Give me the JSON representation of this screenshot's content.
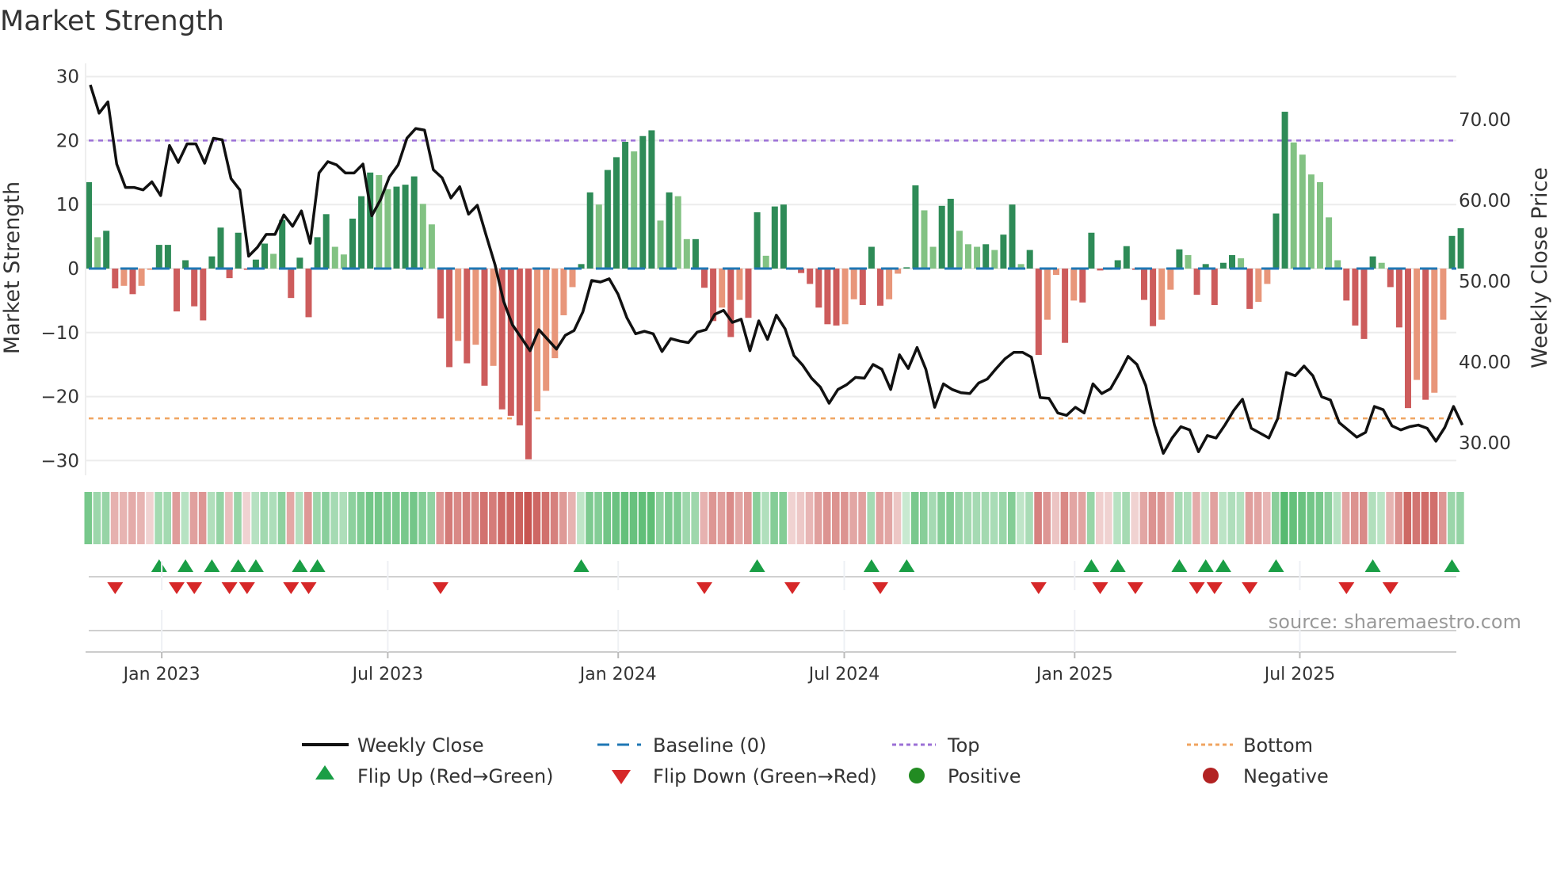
{
  "title": "Market Strength",
  "source": "source: sharemaestro.com",
  "chart_data": {
    "type": "bar",
    "title": "Market Strength",
    "ylabel": "Market Strength",
    "y2label": "Weekly Close Price",
    "ylim": [
      -32,
      32
    ],
    "y2lim": [
      26.6,
      76.2
    ],
    "yticks": [
      30,
      20,
      10,
      0,
      -10,
      -20,
      -30
    ],
    "yticklabels": [
      "30",
      "20",
      "10",
      "0",
      "−10",
      "−20",
      "−30"
    ],
    "y2ticks": [
      70,
      60,
      50,
      40,
      30
    ],
    "y2ticklabels": [
      "70.00",
      "60.00",
      "50.00",
      "40.00",
      "30.00"
    ],
    "xticks": [
      {
        "week": 8.3,
        "label": "Jan 2023"
      },
      {
        "week": 34.0,
        "label": "Jul 2023"
      },
      {
        "week": 60.2,
        "label": "Jan 2024"
      },
      {
        "week": 85.9,
        "label": "Jul 2024"
      },
      {
        "week": 112.1,
        "label": "Jan 2025"
      },
      {
        "week": 137.7,
        "label": "Jul 2025"
      }
    ],
    "top_level": 20,
    "bottom_level": -23.4,
    "baseline": 0,
    "strength": [
      13.5,
      4.9,
      5.9,
      -3.1,
      -2.7,
      -4.0,
      -2.7,
      -0.2,
      3.7,
      3.7,
      -6.7,
      1.3,
      -5.9,
      -8.1,
      1.9,
      6.4,
      -1.5,
      5.6,
      -0.2,
      1.4,
      3.9,
      2.3,
      7.6,
      -4.6,
      1.7,
      -7.6,
      4.9,
      8.5,
      3.4,
      2.2,
      7.8,
      11.3,
      15.0,
      14.6,
      12.4,
      12.8,
      13.1,
      14.4,
      10.1,
      6.9,
      -7.8,
      -15.4,
      -11.3,
      -14.8,
      -11.9,
      -18.3,
      -15.2,
      -22.0,
      -23.0,
      -24.5,
      -29.8,
      -22.3,
      -19.1,
      -14.0,
      -7.3,
      -2.9,
      0.7,
      11.9,
      10.0,
      15.4,
      17.4,
      19.8,
      18.3,
      20.7,
      21.6,
      7.5,
      11.9,
      11.3,
      4.6,
      4.6,
      -3.0,
      -8.2,
      -6.1,
      -10.7,
      -4.9,
      -7.7,
      8.8,
      2.0,
      9.7,
      10.0,
      -0.2,
      -0.7,
      -2.4,
      -6.1,
      -8.7,
      -8.9,
      -8.7,
      -4.8,
      -5.7,
      3.4,
      -5.8,
      -4.8,
      -0.8,
      0.2,
      13.0,
      9.1,
      3.4,
      9.8,
      10.9,
      5.9,
      3.8,
      3.4,
      3.8,
      2.9,
      5.3,
      10.0,
      0.7,
      2.9,
      -13.5,
      -8.0,
      -1.0,
      -11.6,
      -5.0,
      -5.3,
      5.6,
      -0.3,
      -0.2,
      1.3,
      3.5,
      -0.2,
      -4.9,
      -9.0,
      -8.0,
      -3.3,
      3.0,
      2.1,
      -4.1,
      0.7,
      -5.7,
      0.9,
      2.1,
      1.6,
      -6.3,
      -5.2,
      -2.4,
      8.6,
      24.5,
      19.7,
      17.8,
      14.7,
      13.5,
      8.0,
      1.3,
      -5.0,
      -8.9,
      -11.0,
      1.9,
      0.9,
      -2.9,
      -9.2,
      -21.8,
      -17.4,
      -20.5,
      -19.4,
      -8.0,
      5.1,
      6.3
    ],
    "close": [
      74.3,
      70.8,
      72.2,
      64.5,
      61.6,
      61.6,
      61.3,
      62.3,
      60.6,
      66.8,
      64.7,
      67.0,
      67.0,
      64.6,
      67.7,
      67.5,
      62.7,
      61.3,
      53.1,
      54.2,
      55.8,
      55.8,
      58.2,
      56.8,
      58.7,
      54.7,
      63.4,
      64.8,
      64.4,
      63.4,
      63.4,
      64.5,
      58.1,
      60.1,
      62.9,
      64.4,
      67.7,
      68.9,
      68.7,
      63.8,
      62.8,
      60.3,
      61.7,
      58.3,
      59.4,
      55.7,
      52.1,
      47.5,
      44.6,
      43.0,
      41.4,
      44.0,
      42.8,
      41.6,
      43.3,
      43.9,
      46.2,
      50.1,
      49.9,
      50.3,
      48.4,
      45.5,
      43.5,
      43.8,
      43.5,
      41.3,
      42.9,
      42.6,
      42.4,
      43.7,
      44.0,
      45.9,
      46.4,
      44.9,
      45.3,
      41.4,
      45.1,
      42.8,
      45.8,
      44.1,
      40.8,
      39.6,
      38.0,
      36.9,
      34.9,
      36.6,
      37.2,
      38.1,
      38.0,
      39.7,
      39.1,
      36.6,
      40.9,
      39.2,
      41.8,
      39.1,
      34.4,
      37.3,
      36.6,
      36.2,
      36.1,
      37.4,
      37.9,
      39.2,
      40.4,
      41.2,
      41.2,
      40.6,
      35.6,
      35.5,
      33.7,
      33.4,
      34.4,
      33.7,
      37.3,
      36.1,
      36.7,
      38.6,
      40.7,
      39.7,
      37.1,
      32.2,
      28.7,
      30.6,
      32.0,
      31.6,
      28.9,
      30.9,
      30.6,
      32.2,
      34.0,
      35.4,
      31.8,
      31.2,
      30.6,
      33.0,
      38.7,
      38.3,
      39.5,
      38.3,
      35.7,
      35.3,
      32.5,
      31.6,
      30.7,
      31.3,
      34.5,
      34.1,
      32.1,
      31.6,
      32.0,
      32.2,
      31.8,
      30.2,
      31.9,
      34.5,
      32.2
    ],
    "colors": {
      "rising_positive": "#2e8b57",
      "falling_positive": "#82c283",
      "falling_negative": "#cd5c5c",
      "rising_negative": "#e8967a",
      "close": "#111111",
      "baseline": "#1f77b4",
      "top": "#9b6fd6",
      "bottom": "#f0a460",
      "flip_up": "#1a9e45",
      "flip_down": "#d62728",
      "positive": "#228b22",
      "negative": "#b22222"
    },
    "legend": {
      "placement": "bottom",
      "items": [
        {
          "label": "Weekly Close",
          "marker": "line"
        },
        {
          "label": "Baseline (0)",
          "marker": "dashed-line"
        },
        {
          "label": "Top",
          "marker": "dotted-line"
        },
        {
          "label": "Bottom",
          "marker": "dotted-line"
        },
        {
          "label": "Flip Up (Red→Green)",
          "marker": "triangle-up"
        },
        {
          "label": "Flip Down (Green→Red)",
          "marker": "triangle-down"
        },
        {
          "label": "Positive",
          "marker": "circle"
        },
        {
          "label": "Negative",
          "marker": "circle"
        }
      ]
    }
  }
}
